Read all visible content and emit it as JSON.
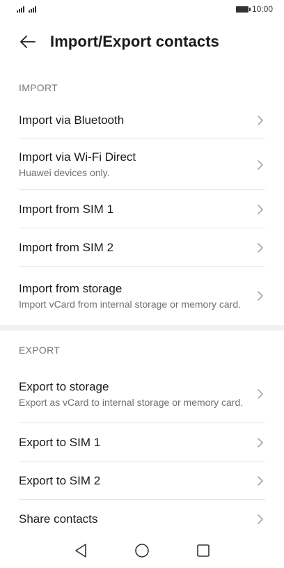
{
  "status_bar": {
    "time": "10:00"
  },
  "header": {
    "title": "Import/Export contacts"
  },
  "import_section": {
    "label": "IMPORT",
    "items": [
      {
        "title": "Import via Bluetooth",
        "subtitle": ""
      },
      {
        "title": "Import via Wi-Fi Direct",
        "subtitle": "Huawei devices only."
      },
      {
        "title": "Import from SIM 1",
        "subtitle": ""
      },
      {
        "title": "Import from SIM 2",
        "subtitle": ""
      },
      {
        "title": "Import from storage",
        "subtitle": "Import vCard from internal storage or memory card."
      }
    ]
  },
  "export_section": {
    "label": "EXPORT",
    "items": [
      {
        "title": "Export to storage",
        "subtitle": "Export as vCard to internal storage or memory card."
      },
      {
        "title": "Export to SIM 1",
        "subtitle": ""
      },
      {
        "title": "Export to SIM 2",
        "subtitle": ""
      },
      {
        "title": "Share contacts",
        "subtitle": ""
      }
    ]
  },
  "icons": {
    "back": "arrow-left-icon",
    "chevron": "chevron-right-icon",
    "nav_back": "triangle-back-icon",
    "nav_home": "circle-home-icon",
    "nav_recents": "square-recents-icon"
  }
}
